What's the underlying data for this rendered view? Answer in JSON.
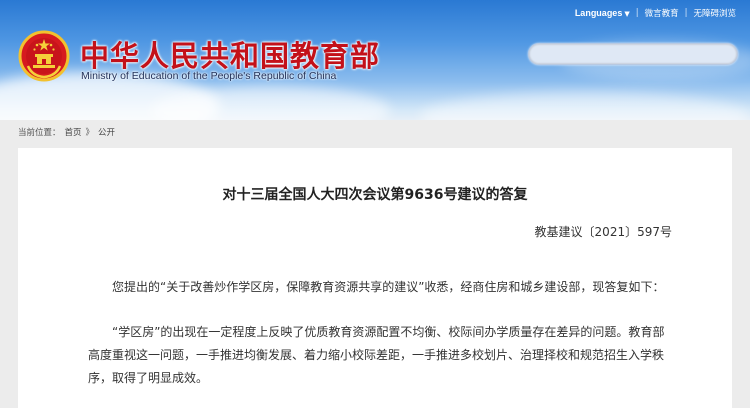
{
  "header": {
    "site_title": "中华人民共和国教育部",
    "site_subtitle": "Ministry of Education of the People's Republic of China",
    "nav": {
      "languages": "Languages",
      "weibo": "微言教育",
      "accessibility": "无障碍浏览"
    },
    "search": {
      "value": "",
      "placeholder": ""
    }
  },
  "breadcrumb": {
    "prefix": "当前位置：",
    "home": "首页",
    "separator": "》",
    "current": "公开"
  },
  "article": {
    "title": "对十三届全国人大四次会议第9636号建议的答复",
    "doc_number": "教基建议〔2021〕597号",
    "paragraphs": [
      "您提出的“关于改善炒作学区房，保障教育资源共享的建议”收悉，经商住房和城乡建设部，现答复如下：",
      "“学区房”的出现在一定程度上反映了优质教育资源配置不均衡、校际间办学质量存在差异的问题。教育部高度重视这一问题，一手推进均衡发展、着力缩小校际差距，一手推进多校划片、治理择校和规范招生入学秩序，取得了明显成效。"
    ]
  },
  "colors": {
    "header_blue": "#2a79d3",
    "title_red": "#c3111a",
    "page_bg": "#ececec"
  }
}
